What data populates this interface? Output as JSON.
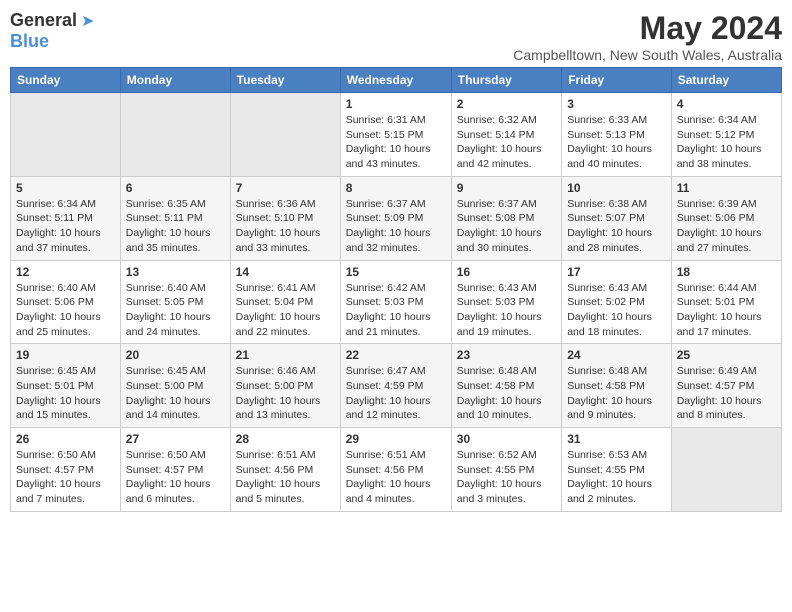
{
  "header": {
    "logo": {
      "general": "General",
      "blue": "Blue"
    },
    "title": "May 2024",
    "location": "Campbelltown, New South Wales, Australia"
  },
  "weekdays": [
    "Sunday",
    "Monday",
    "Tuesday",
    "Wednesday",
    "Thursday",
    "Friday",
    "Saturday"
  ],
  "weeks": [
    [
      {
        "day": "",
        "sunrise": "",
        "sunset": "",
        "daylight": "",
        "empty": true
      },
      {
        "day": "",
        "sunrise": "",
        "sunset": "",
        "daylight": "",
        "empty": true
      },
      {
        "day": "",
        "sunrise": "",
        "sunset": "",
        "daylight": "",
        "empty": true
      },
      {
        "day": "1",
        "sunrise": "Sunrise: 6:31 AM",
        "sunset": "Sunset: 5:15 PM",
        "daylight": "Daylight: 10 hours and 43 minutes."
      },
      {
        "day": "2",
        "sunrise": "Sunrise: 6:32 AM",
        "sunset": "Sunset: 5:14 PM",
        "daylight": "Daylight: 10 hours and 42 minutes."
      },
      {
        "day": "3",
        "sunrise": "Sunrise: 6:33 AM",
        "sunset": "Sunset: 5:13 PM",
        "daylight": "Daylight: 10 hours and 40 minutes."
      },
      {
        "day": "4",
        "sunrise": "Sunrise: 6:34 AM",
        "sunset": "Sunset: 5:12 PM",
        "daylight": "Daylight: 10 hours and 38 minutes."
      }
    ],
    [
      {
        "day": "5",
        "sunrise": "Sunrise: 6:34 AM",
        "sunset": "Sunset: 5:11 PM",
        "daylight": "Daylight: 10 hours and 37 minutes."
      },
      {
        "day": "6",
        "sunrise": "Sunrise: 6:35 AM",
        "sunset": "Sunset: 5:11 PM",
        "daylight": "Daylight: 10 hours and 35 minutes."
      },
      {
        "day": "7",
        "sunrise": "Sunrise: 6:36 AM",
        "sunset": "Sunset: 5:10 PM",
        "daylight": "Daylight: 10 hours and 33 minutes."
      },
      {
        "day": "8",
        "sunrise": "Sunrise: 6:37 AM",
        "sunset": "Sunset: 5:09 PM",
        "daylight": "Daylight: 10 hours and 32 minutes."
      },
      {
        "day": "9",
        "sunrise": "Sunrise: 6:37 AM",
        "sunset": "Sunset: 5:08 PM",
        "daylight": "Daylight: 10 hours and 30 minutes."
      },
      {
        "day": "10",
        "sunrise": "Sunrise: 6:38 AM",
        "sunset": "Sunset: 5:07 PM",
        "daylight": "Daylight: 10 hours and 28 minutes."
      },
      {
        "day": "11",
        "sunrise": "Sunrise: 6:39 AM",
        "sunset": "Sunset: 5:06 PM",
        "daylight": "Daylight: 10 hours and 27 minutes."
      }
    ],
    [
      {
        "day": "12",
        "sunrise": "Sunrise: 6:40 AM",
        "sunset": "Sunset: 5:06 PM",
        "daylight": "Daylight: 10 hours and 25 minutes."
      },
      {
        "day": "13",
        "sunrise": "Sunrise: 6:40 AM",
        "sunset": "Sunset: 5:05 PM",
        "daylight": "Daylight: 10 hours and 24 minutes."
      },
      {
        "day": "14",
        "sunrise": "Sunrise: 6:41 AM",
        "sunset": "Sunset: 5:04 PM",
        "daylight": "Daylight: 10 hours and 22 minutes."
      },
      {
        "day": "15",
        "sunrise": "Sunrise: 6:42 AM",
        "sunset": "Sunset: 5:03 PM",
        "daylight": "Daylight: 10 hours and 21 minutes."
      },
      {
        "day": "16",
        "sunrise": "Sunrise: 6:43 AM",
        "sunset": "Sunset: 5:03 PM",
        "daylight": "Daylight: 10 hours and 19 minutes."
      },
      {
        "day": "17",
        "sunrise": "Sunrise: 6:43 AM",
        "sunset": "Sunset: 5:02 PM",
        "daylight": "Daylight: 10 hours and 18 minutes."
      },
      {
        "day": "18",
        "sunrise": "Sunrise: 6:44 AM",
        "sunset": "Sunset: 5:01 PM",
        "daylight": "Daylight: 10 hours and 17 minutes."
      }
    ],
    [
      {
        "day": "19",
        "sunrise": "Sunrise: 6:45 AM",
        "sunset": "Sunset: 5:01 PM",
        "daylight": "Daylight: 10 hours and 15 minutes."
      },
      {
        "day": "20",
        "sunrise": "Sunrise: 6:45 AM",
        "sunset": "Sunset: 5:00 PM",
        "daylight": "Daylight: 10 hours and 14 minutes."
      },
      {
        "day": "21",
        "sunrise": "Sunrise: 6:46 AM",
        "sunset": "Sunset: 5:00 PM",
        "daylight": "Daylight: 10 hours and 13 minutes."
      },
      {
        "day": "22",
        "sunrise": "Sunrise: 6:47 AM",
        "sunset": "Sunset: 4:59 PM",
        "daylight": "Daylight: 10 hours and 12 minutes."
      },
      {
        "day": "23",
        "sunrise": "Sunrise: 6:48 AM",
        "sunset": "Sunset: 4:58 PM",
        "daylight": "Daylight: 10 hours and 10 minutes."
      },
      {
        "day": "24",
        "sunrise": "Sunrise: 6:48 AM",
        "sunset": "Sunset: 4:58 PM",
        "daylight": "Daylight: 10 hours and 9 minutes."
      },
      {
        "day": "25",
        "sunrise": "Sunrise: 6:49 AM",
        "sunset": "Sunset: 4:57 PM",
        "daylight": "Daylight: 10 hours and 8 minutes."
      }
    ],
    [
      {
        "day": "26",
        "sunrise": "Sunrise: 6:50 AM",
        "sunset": "Sunset: 4:57 PM",
        "daylight": "Daylight: 10 hours and 7 minutes."
      },
      {
        "day": "27",
        "sunrise": "Sunrise: 6:50 AM",
        "sunset": "Sunset: 4:57 PM",
        "daylight": "Daylight: 10 hours and 6 minutes."
      },
      {
        "day": "28",
        "sunrise": "Sunrise: 6:51 AM",
        "sunset": "Sunset: 4:56 PM",
        "daylight": "Daylight: 10 hours and 5 minutes."
      },
      {
        "day": "29",
        "sunrise": "Sunrise: 6:51 AM",
        "sunset": "Sunset: 4:56 PM",
        "daylight": "Daylight: 10 hours and 4 minutes."
      },
      {
        "day": "30",
        "sunrise": "Sunrise: 6:52 AM",
        "sunset": "Sunset: 4:55 PM",
        "daylight": "Daylight: 10 hours and 3 minutes."
      },
      {
        "day": "31",
        "sunrise": "Sunrise: 6:53 AM",
        "sunset": "Sunset: 4:55 PM",
        "daylight": "Daylight: 10 hours and 2 minutes."
      },
      {
        "day": "",
        "sunrise": "",
        "sunset": "",
        "daylight": "",
        "empty": true
      }
    ]
  ]
}
